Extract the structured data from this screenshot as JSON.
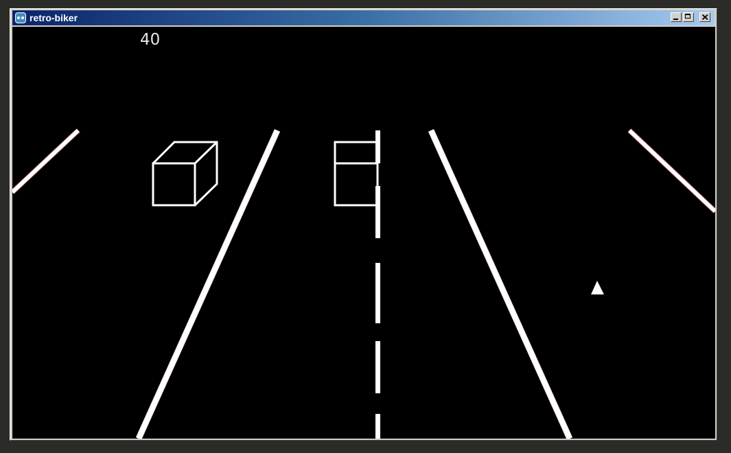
{
  "window": {
    "title": "retro-biker",
    "icon": "godot-engine-icon",
    "controls": [
      "minimize",
      "maximize",
      "close"
    ]
  },
  "hud": {
    "score": "40"
  },
  "colors": {
    "background": "#000000",
    "lines": "#ffffff",
    "edge_tint": "#ff6a6a",
    "titlebar_start": "#0a246a",
    "titlebar_end": "#a6caf0"
  }
}
